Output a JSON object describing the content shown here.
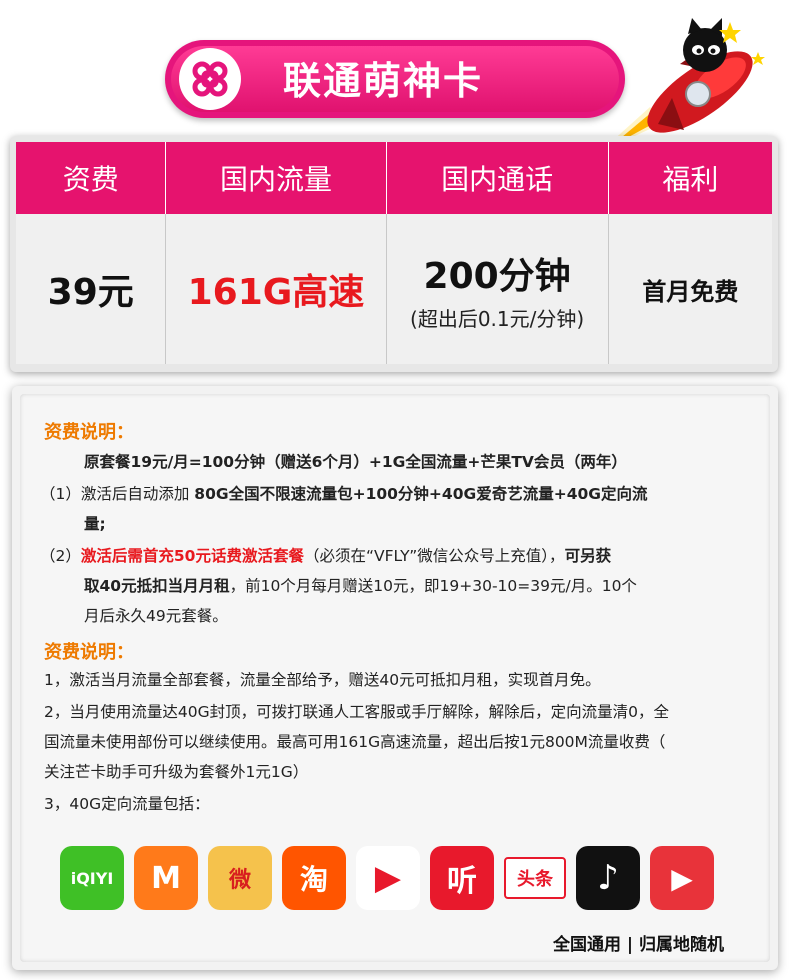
{
  "header": {
    "title": "联通萌神卡",
    "logo_icon": "china-unicom-knot-icon",
    "decor": "tmall-cat-rocket-icon"
  },
  "colors": {
    "brand": "#e6136e",
    "accent_red": "#e8191e",
    "section_orange": "#ee7a00"
  },
  "plan_table": {
    "headers": [
      "资费",
      "国内流量",
      "国内通话",
      "福利"
    ],
    "values": {
      "fee": "39元",
      "data": "161G高速",
      "calls": "200分钟",
      "calls_note": "(超出后0.1元/分钟)",
      "benefit": "首月免费"
    }
  },
  "details": {
    "section1_title": "资费说明：",
    "line_original": "原套餐19元/月=100分钟（赠送6个月）+1G全国流量+芒果TV会员（两年）",
    "item1_prefix": "（1）激活后自动添加 ",
    "item1_bold": "80G全国不限速流量包+100分钟+40G爱奇艺流量+40G定向流",
    "item1_bold_cont": "量;",
    "item2_prefix": "（2）",
    "item2_red": "激活后需首充50元话费激活套餐",
    "item2_mid": "（必须在“VFLY”微信公众号上充值），",
    "item2_bold": "可另获",
    "item2_bold_cont": "取40元抵扣当月月租",
    "item2_tail": "，前10个月每月赠送10元，即19+30-10=39元/月。10个",
    "item2_tail2": "月后永久49元套餐。",
    "section2_title": "资费说明：",
    "note1": "1，激活当月流量全部套餐，流量全部给予，赠送40元可抵扣月租，实现首月免。",
    "note2a": "2，当月使用流量达40G封顶，可拨打联通人工客服或手厅解除，解除后，定向流量清0，全",
    "note2b": "国流量未使用部份可以继续使用。最高可用161G高速流量，超出后按1元800M流量收费（",
    "note2c": "关注芒卡助手可升级为套餐外1元1G）",
    "note3": "3，40G定向流量包括：",
    "footer": "全国通用 | 归属地随机"
  },
  "apps": [
    {
      "name": "iqiyi-icon",
      "label": "iQIYI",
      "color": "#3fc026"
    },
    {
      "name": "mango-tv-icon",
      "label": "M",
      "color": "#ff7a1a"
    },
    {
      "name": "weibo-icon",
      "label": "微",
      "color": "#f5c24c"
    },
    {
      "name": "taobao-icon",
      "label": "淘",
      "color": "#ff5500"
    },
    {
      "name": "video-play-icon",
      "label": "▶",
      "color": "#e8192c"
    },
    {
      "name": "ting-icon",
      "label": "听",
      "color": "#e8192c"
    },
    {
      "name": "toutiao-icon",
      "label": "头条",
      "color": "#e8192c"
    },
    {
      "name": "douyin-icon",
      "label": "♪",
      "color": "#111111"
    },
    {
      "name": "huoshan-icon",
      "label": "▶",
      "color": "#e8333a"
    }
  ]
}
